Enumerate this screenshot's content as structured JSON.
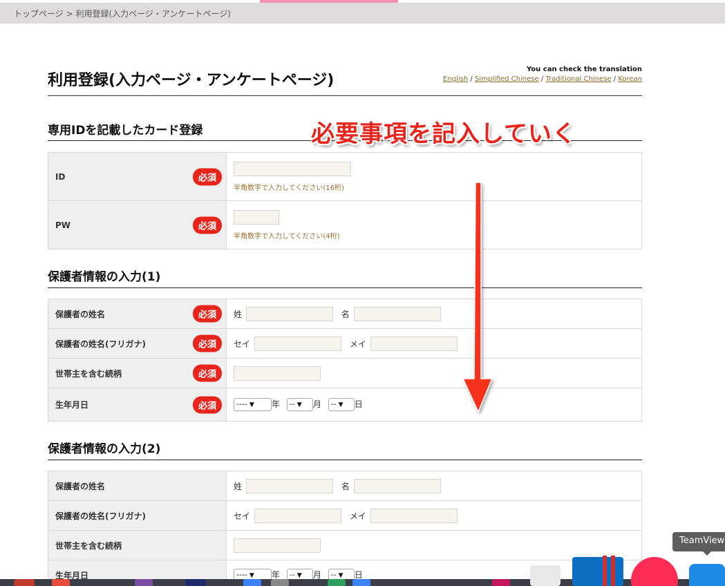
{
  "breadcrumb": {
    "home": "トップページ",
    "separator": ">",
    "current": "利用登録(入力ページ・アンケートページ)"
  },
  "page_title": "利用登録(入力ページ・アンケートページ)",
  "translation": {
    "heading": "You can check the translation",
    "languages": [
      "English",
      "Simplified Chinese",
      "Traditional Chinese",
      "Korean"
    ],
    "separator": "/"
  },
  "annotation": "必要事項を記入していく",
  "required_label": "必須",
  "sections": {
    "card": {
      "title": "専用IDを記載したカード登録",
      "rows": {
        "id": {
          "label": "ID",
          "hint": "半角数字で入力してください(16桁)"
        },
        "pw": {
          "label": "PW",
          "hint": "半角数字で入力してください(4桁)"
        }
      }
    },
    "guardian1": {
      "title": "保護者情報の入力(1)",
      "rows": {
        "name": {
          "label": "保護者の姓名",
          "sei": "姓",
          "mei": "名"
        },
        "kana": {
          "label": "保護者の姓名(フリガナ)",
          "sei": "セイ",
          "mei": "メイ"
        },
        "relation": {
          "label": "世帯主を含む続柄"
        },
        "birth": {
          "label": "生年月日",
          "year_value": "----",
          "year_unit": "年",
          "month_value": "--",
          "month_unit": "月",
          "day_value": "--",
          "day_unit": "日"
        }
      }
    },
    "guardian2": {
      "title": "保護者情報の入力(2)",
      "rows": {
        "name": {
          "label": "保護者の姓名",
          "sei": "姓",
          "mei": "名"
        },
        "kana": {
          "label": "保護者の姓名(フリガナ)",
          "sei": "セイ",
          "mei": "メイ"
        },
        "relation": {
          "label": "世帯主を含む続柄"
        },
        "birth": {
          "label": "生年月日",
          "year_value": "----",
          "year_unit": "年",
          "month_value": "--",
          "month_unit": "月",
          "day_value": "--",
          "day_unit": "日"
        }
      }
    }
  },
  "tooltip": "TeamView",
  "colors": {
    "required": "#e8251d",
    "hint": "#9a6a2a",
    "link": "#8b6a2d",
    "label_bg": "#efefef",
    "input_bg": "#f7f3ef",
    "topbar_accent": "#f48fb1"
  }
}
